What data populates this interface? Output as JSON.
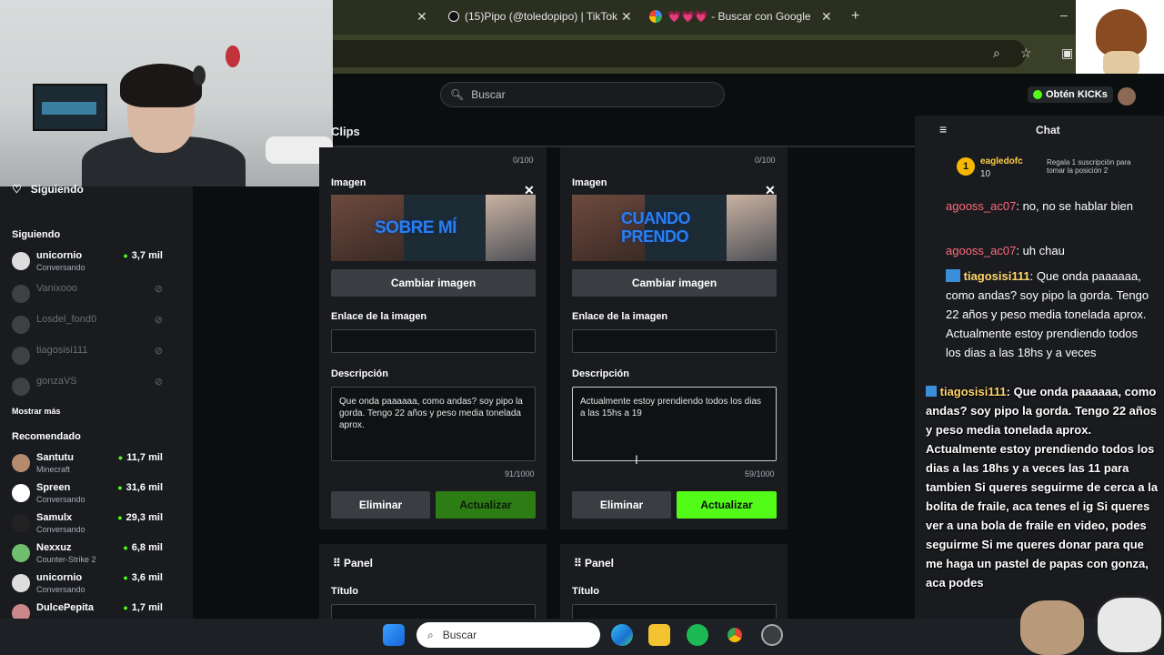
{
  "browser": {
    "tabs": [
      {
        "label": "(15)Pipo (@toledopipo) | TikTok"
      },
      {
        "label": "💗💗💗 - Buscar con Google"
      }
    ],
    "new_tab": "+",
    "minimize": "–"
  },
  "header": {
    "search_placeholder": "Buscar",
    "kicks_label": "Obtén KICKs"
  },
  "sidebar": {
    "following_title": "Siguiendo",
    "following_heading": "Siguiendo",
    "following": [
      {
        "name": "unicornio",
        "sub": "Conversando",
        "viewers": "3,7 mil",
        "online": true
      },
      {
        "name": "Vanixooo",
        "sub": "",
        "viewers": "",
        "online": false
      },
      {
        "name": "Losdel_fond0",
        "sub": "",
        "viewers": "",
        "online": false
      },
      {
        "name": "tiagosisi111",
        "sub": "",
        "viewers": "",
        "online": false
      },
      {
        "name": "gonzaVS",
        "sub": "",
        "viewers": "",
        "online": false
      }
    ],
    "show_more": "Mostrar más",
    "recommended_heading": "Recomendado",
    "recommended": [
      {
        "name": "Santutu",
        "sub": "Minecraft",
        "viewers": "11,7 mil"
      },
      {
        "name": "Spreen",
        "sub": "Conversando",
        "viewers": "31,6 mil"
      },
      {
        "name": "Samulx",
        "sub": "Conversando",
        "viewers": "29,3 mil"
      },
      {
        "name": "Nexxuz",
        "sub": "Counter-Strike 2",
        "viewers": "6,8 mil"
      },
      {
        "name": "unicornio",
        "sub": "Conversando",
        "viewers": "3,6 mil"
      },
      {
        "name": "DulcePepita",
        "sub": "",
        "viewers": "1,7 mil"
      }
    ]
  },
  "main": {
    "section_title": "Clips",
    "panels": [
      {
        "title_counter": "0/100",
        "image_label": "Imagen",
        "image_text": "SOBRE MÍ",
        "change_image": "Cambiar imagen",
        "link_label": "Enlace de la imagen",
        "link_value": "",
        "description_label": "Descripción",
        "description": "Que onda paaaaaa, como andas? soy pipo la gorda. Tengo 22 años y peso media tonelada aprox.",
        "description_counter": "91/1000",
        "delete": "Eliminar",
        "update": "Actualizar"
      },
      {
        "title_counter": "0/100",
        "image_label": "Imagen",
        "image_text_1": "CUANDO",
        "image_text_2": "PRENDO",
        "change_image": "Cambiar imagen",
        "link_label": "Enlace de la imagen",
        "link_value": "",
        "description_label": "Descripción",
        "description": "Actualmente estoy prendiendo todos los dias a las 15hs a 19",
        "description_counter": "59/1000",
        "delete": "Eliminar",
        "update": "Actualizar"
      }
    ],
    "new_panels": [
      {
        "title": "Panel",
        "field_label": "Título"
      },
      {
        "title": "Panel",
        "field_label": "Título"
      }
    ]
  },
  "chat": {
    "title": "Chat",
    "pinned_user": "eagledofc",
    "pinned_count": "10",
    "pinned_rank": "1",
    "pinned_text": "Regala 1 suscripción para tomar la posición 2",
    "messages": [
      {
        "user": "agooss_ac07",
        "text": ": no, no se hablar bien"
      },
      {
        "user": "agooss_ac07",
        "text": ": uh chau"
      },
      {
        "user": "tiagosisi111",
        "text": ": Que onda paaaaaa, como andas? soy pipo la gorda. Tengo 22 años y peso media tonelada aprox. Actualmente estoy prendiendo todos los dias a las 18hs y a veces"
      }
    ],
    "overlay_user": "tiagosisi111",
    "overlay_text": ": Que onda paaaaaa, como andas? soy pipo la gorda. Tengo 22 años y peso media tonelada aprox. Actualmente estoy prendiendo todos los dias a las 18hs y a veces las 11 para tambien Si queres seguirme de cerca a la bolita de fraile, aca tenes el ig Si queres ver a una bola de fraile en video, podes seguirme Si me queres donar para que me haga un pastel de papas con gonza, aca podes"
  },
  "taskbar": {
    "search_placeholder": "Buscar"
  },
  "colors": {
    "kick_green": "#53fc18",
    "background": "#0b0e0f",
    "panel": "#191b1f"
  }
}
